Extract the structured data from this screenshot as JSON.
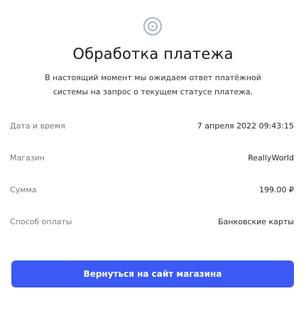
{
  "icon": "pending-status-icon",
  "title": "Обработка платежа",
  "description": "В настоящий момент мы ожидаем ответ платёжной системы на запрос о текущем статусе платежа.",
  "details": [
    {
      "label": "Дата и время",
      "value": "7 апреля 2022 09:43:15"
    },
    {
      "label": "Магазин",
      "value": "ReallyWorld"
    },
    {
      "label": "Сумма",
      "value": "199.00 ₽"
    },
    {
      "label": "Способ оплаты",
      "value": "Банковские карты"
    }
  ],
  "button": {
    "label": "Вернуться на сайт магазина"
  },
  "colors": {
    "accent": "#3a59f5",
    "icon": "#a9b4c6"
  }
}
